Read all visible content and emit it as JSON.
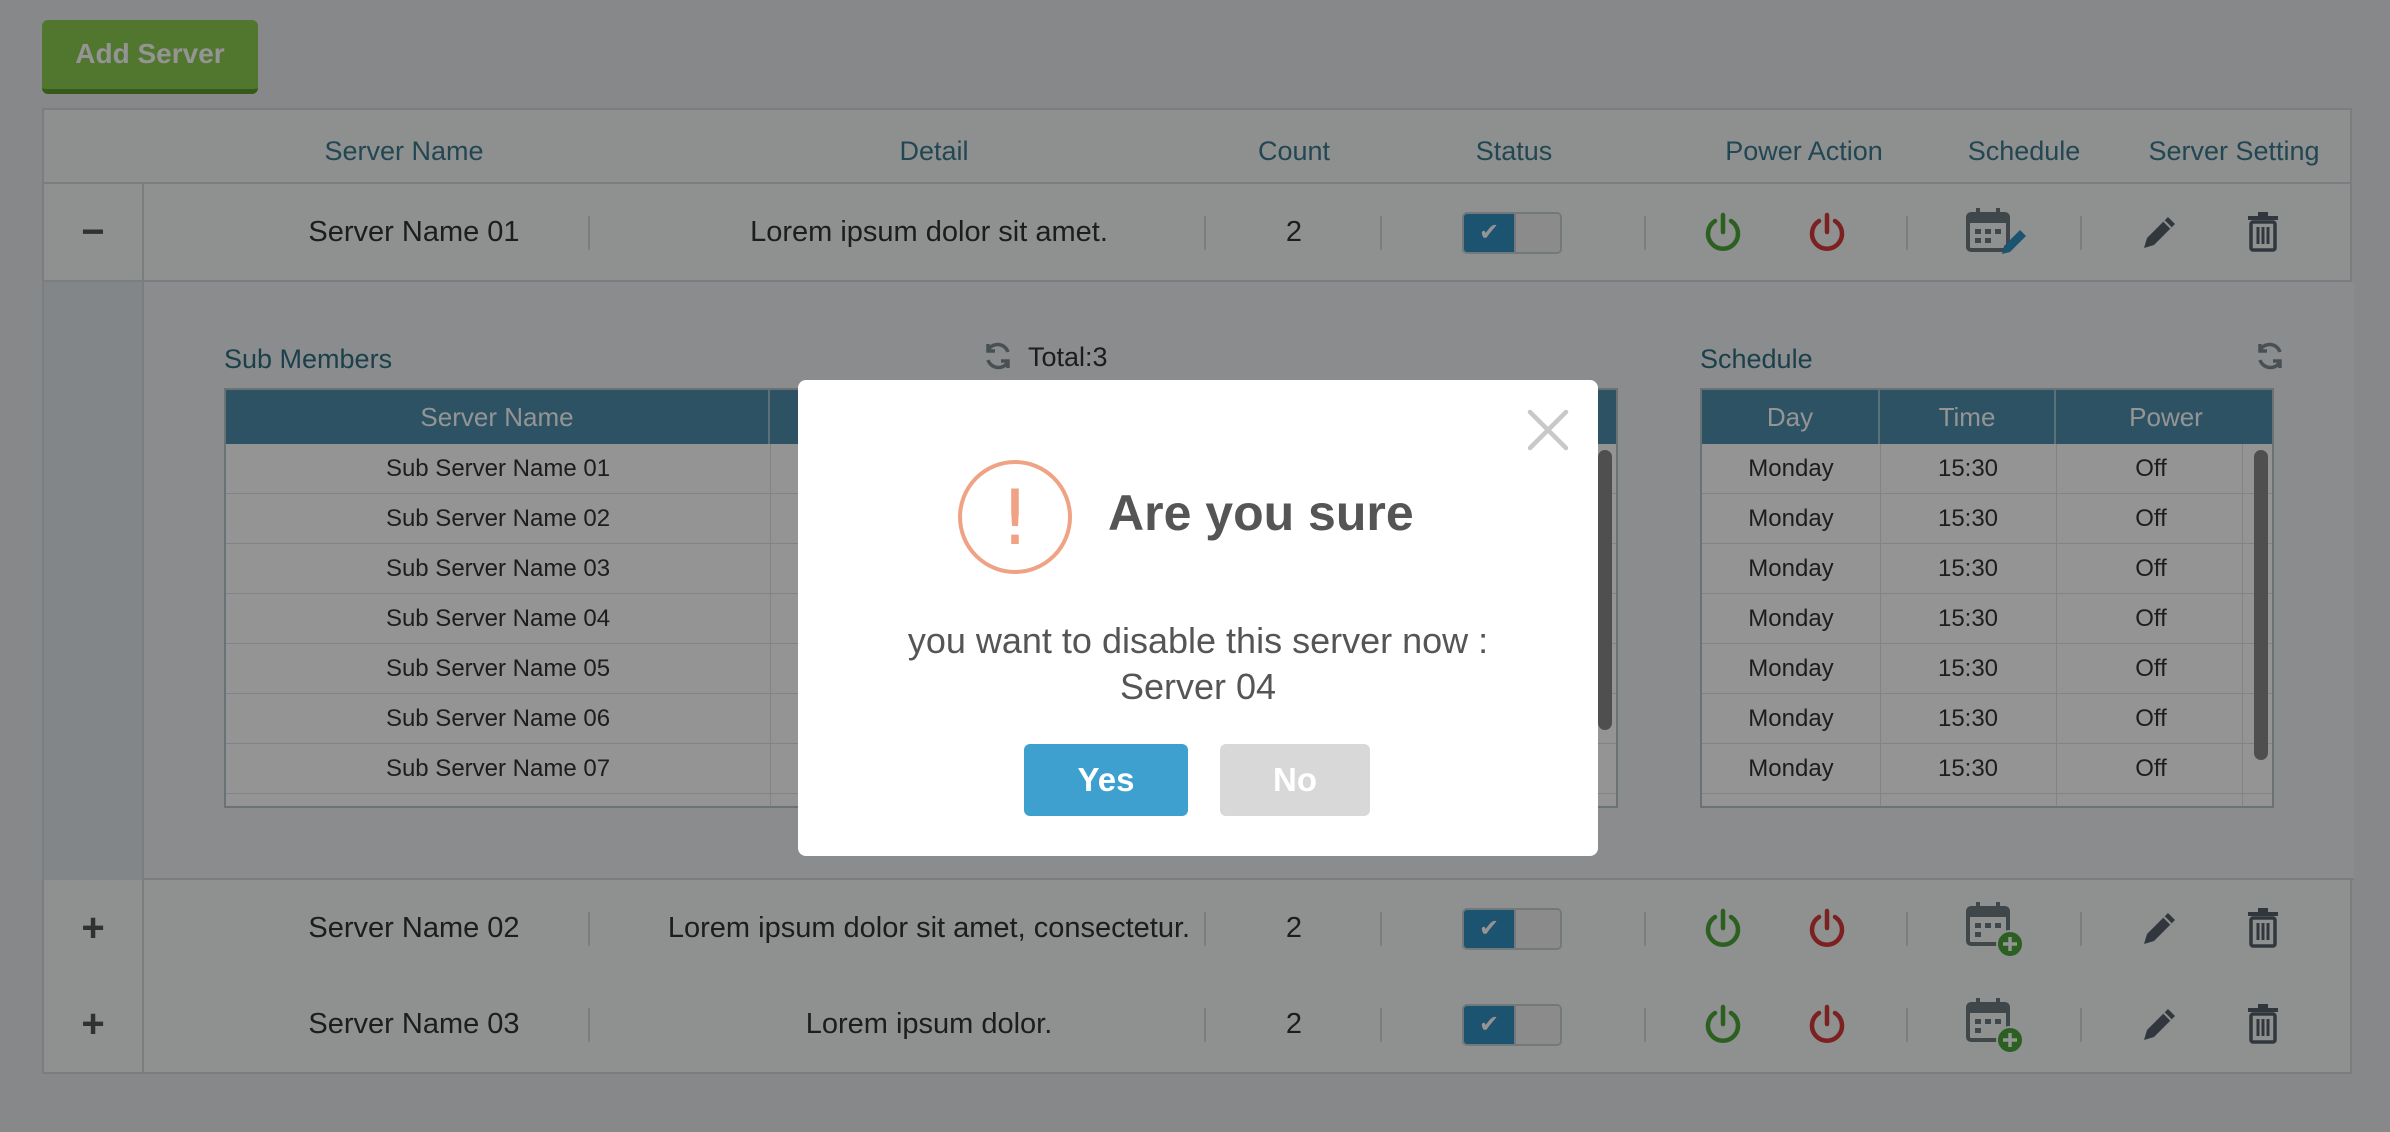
{
  "toolbar": {
    "add_server_label": "Add Server"
  },
  "table": {
    "headers": {
      "server_name": "Server Name",
      "detail": "Detail",
      "count": "Count",
      "status": "Status",
      "power_action": "Power Action",
      "schedule": "Schedule",
      "server_setting": "Server Setting"
    },
    "rows": [
      {
        "expander": "−",
        "name": "Server Name 01",
        "detail": "Lorem ipsum dolor sit amet.",
        "count": "2",
        "status_enabled": true
      },
      {
        "expander": "+",
        "name": "Server Name 02",
        "detail": "Lorem ipsum dolor sit amet, consectetur.",
        "count": "2",
        "status_enabled": true
      },
      {
        "expander": "+",
        "name": "Server Name 03",
        "detail": "Lorem ipsum dolor.",
        "count": "2",
        "status_enabled": true
      }
    ]
  },
  "sub_members": {
    "title": "Sub Members",
    "total": "Total:3",
    "header_server_name": "Server Name",
    "rows": [
      "Sub Server Name 01",
      "Sub Server Name 02",
      "Sub Server Name 03",
      "Sub Server Name 04",
      "Sub Server Name 05",
      "Sub Server Name 06",
      "Sub Server Name 07"
    ]
  },
  "schedule_panel": {
    "title": "Schedule",
    "headers": {
      "day": "Day",
      "time": "Time",
      "power": "Power"
    },
    "rows": [
      {
        "day": "Monday",
        "time": "15:30",
        "power": "Off"
      },
      {
        "day": "Monday",
        "time": "15:30",
        "power": "Off"
      },
      {
        "day": "Monday",
        "time": "15:30",
        "power": "Off"
      },
      {
        "day": "Monday",
        "time": "15:30",
        "power": "Off"
      },
      {
        "day": "Monday",
        "time": "15:30",
        "power": "Off"
      },
      {
        "day": "Monday",
        "time": "15:30",
        "power": "Off"
      },
      {
        "day": "Monday",
        "time": "15:30",
        "power": "Off"
      }
    ]
  },
  "dialog": {
    "icon_glyph": "!",
    "title": "Are you sure",
    "message_line1": "you want to disable this server now :",
    "message_line2": "Server 04",
    "yes_label": "Yes",
    "no_label": "No"
  },
  "colors": {
    "add_button": "#8ccb50",
    "header_text": "#3d7a8e",
    "toggle_on": "#2f8fc2",
    "power_on": "#4aa53a",
    "power_off": "#d63a3a",
    "subtable_header": "#4c8eac",
    "dialog_yes": "#3da0cf",
    "dialog_no": "#d8d8d8",
    "warning": "#f0a284"
  },
  "icons": {
    "power_on": "power-on-icon",
    "power_off": "power-off-icon",
    "schedule_edit": "calendar-edit-icon",
    "schedule_add": "calendar-add-icon",
    "edit": "pencil-icon",
    "delete": "trash-icon",
    "refresh": "refresh-icon",
    "close": "close-icon",
    "check": "check-icon",
    "warning": "exclamation-icon"
  }
}
